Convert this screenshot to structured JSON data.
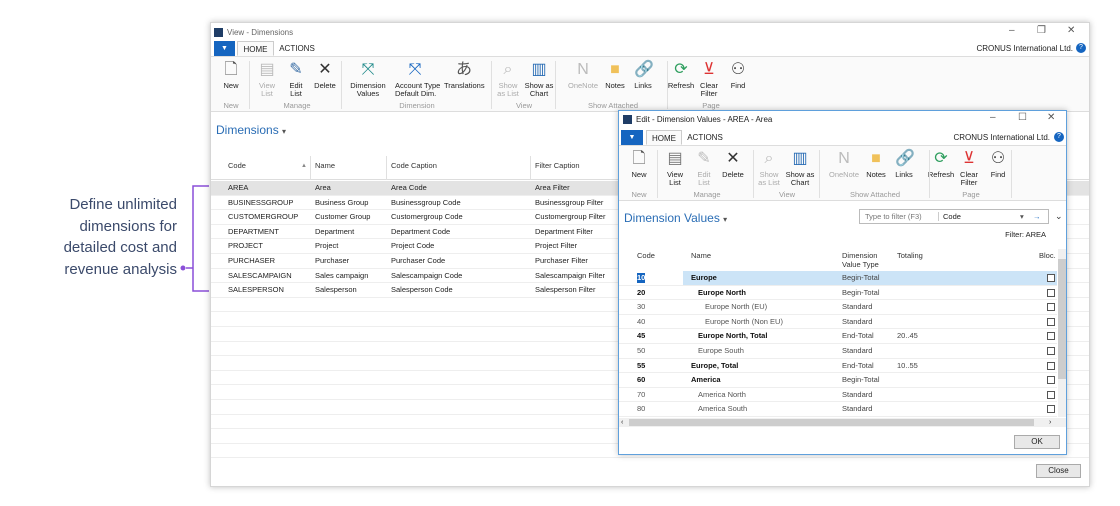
{
  "annotation": {
    "lines": [
      "Define unlimited",
      "dimensions for",
      "detailed cost and",
      "revenue analysis"
    ]
  },
  "colors": {
    "accent": "#1565c0",
    "callout": "#8a4fd8",
    "selected_row": "#cce4f7",
    "title_blue": "#2a6db5"
  },
  "main": {
    "window_title": "View - Dimensions",
    "tabs": [
      "HOME",
      "ACTIONS"
    ],
    "company": "CRONUS International Ltd.",
    "ribbon": {
      "buttons": [
        {
          "label": "New",
          "icon": "new-document-icon"
        },
        {
          "label": "View\nList",
          "icon": "view-list-icon",
          "disabled": true
        },
        {
          "label": "Edit\nList",
          "icon": "edit-list-icon"
        },
        {
          "label": "Delete",
          "icon": "delete-x-icon"
        },
        {
          "label": "Dimension\nValues",
          "icon": "dimension-icon"
        },
        {
          "label": "Account Type\nDefault Dim.",
          "icon": "account-type-icon"
        },
        {
          "label": "Translations",
          "icon": "translations-icon"
        },
        {
          "label": "Show\nas List",
          "icon": "show-list-icon",
          "disabled": true
        },
        {
          "label": "Show as\nChart",
          "icon": "chart-icon"
        },
        {
          "label": "OneNote",
          "icon": "onenote-icon",
          "disabled": true
        },
        {
          "label": "Notes",
          "icon": "notes-icon"
        },
        {
          "label": "Links",
          "icon": "links-icon"
        },
        {
          "label": "Refresh",
          "icon": "refresh-icon"
        },
        {
          "label": "Clear\nFilter",
          "icon": "clear-filter-icon"
        },
        {
          "label": "Find",
          "icon": "find-binoculars-icon"
        }
      ],
      "groups": [
        "New",
        "Manage",
        "Dimension",
        "View",
        "Show Attached",
        "Page"
      ]
    },
    "page_title": "Dimensions",
    "columns": [
      "Code",
      "Name",
      "Code Caption",
      "Filter Caption"
    ],
    "rows": [
      [
        "AREA",
        "Area",
        "Area Code",
        "Area Filter"
      ],
      [
        "BUSINESSGROUP",
        "Business Group",
        "Businessgroup Code",
        "Businessgroup Filter"
      ],
      [
        "CUSTOMERGROUP",
        "Customer Group",
        "Customergroup Code",
        "Customergroup Filter"
      ],
      [
        "DEPARTMENT",
        "Department",
        "Department Code",
        "Department Filter"
      ],
      [
        "PROJECT",
        "Project",
        "Project Code",
        "Project Filter"
      ],
      [
        "PURCHASER",
        "Purchaser",
        "Purchaser Code",
        "Purchaser Filter"
      ],
      [
        "SALESCAMPAIGN",
        "Sales campaign",
        "Salescampaign Code",
        "Salescampaign Filter"
      ],
      [
        "SALESPERSON",
        "Salesperson",
        "Salesperson Code",
        "Salesperson Filter"
      ]
    ],
    "close_label": "Close"
  },
  "dialog": {
    "window_title": "Edit - Dimension Values - AREA - Area",
    "tabs": [
      "HOME",
      "ACTIONS"
    ],
    "company": "CRONUS International Ltd.",
    "ribbon": {
      "buttons": [
        {
          "label": "New",
          "icon": "new-document-icon"
        },
        {
          "label": "View\nList",
          "icon": "view-list-icon"
        },
        {
          "label": "Edit\nList",
          "icon": "edit-list-icon",
          "disabled": true
        },
        {
          "label": "Delete",
          "icon": "delete-x-icon"
        },
        {
          "label": "Show\nas List",
          "icon": "show-list-icon",
          "disabled": true
        },
        {
          "label": "Show as\nChart",
          "icon": "chart-icon"
        },
        {
          "label": "OneNote",
          "icon": "onenote-icon",
          "disabled": true
        },
        {
          "label": "Notes",
          "icon": "notes-icon"
        },
        {
          "label": "Links",
          "icon": "links-icon"
        },
        {
          "label": "Refresh",
          "icon": "refresh-icon"
        },
        {
          "label": "Clear\nFilter",
          "icon": "clear-filter-icon"
        },
        {
          "label": "Find",
          "icon": "find-binoculars-icon"
        }
      ],
      "groups": [
        "New",
        "Manage",
        "View",
        "Show Attached",
        "Page"
      ]
    },
    "page_title": "Dimension Values",
    "filter_placeholder": "Type to filter (F3)",
    "filter_field": "Code",
    "filter_status": "Filter: AREA",
    "columns": [
      "Code",
      "Name",
      "Dimension\nValue Type",
      "Totaling",
      "Bloc."
    ],
    "rows": [
      {
        "code": "10",
        "name": "Europe",
        "type": "Begin-Total",
        "totaling": "",
        "bold": true,
        "indent": 0,
        "blocked": false
      },
      {
        "code": "20",
        "name": "Europe North",
        "type": "Begin-Total",
        "totaling": "",
        "bold": true,
        "indent": 1,
        "blocked": false
      },
      {
        "code": "30",
        "name": "Europe North (EU)",
        "type": "Standard",
        "totaling": "",
        "bold": false,
        "indent": 2,
        "blocked": false
      },
      {
        "code": "40",
        "name": "Europe North (Non EU)",
        "type": "Standard",
        "totaling": "",
        "bold": false,
        "indent": 2,
        "blocked": false
      },
      {
        "code": "45",
        "name": "Europe North, Total",
        "type": "End-Total",
        "totaling": "20..45",
        "bold": true,
        "indent": 1,
        "blocked": false
      },
      {
        "code": "50",
        "name": "Europe South",
        "type": "Standard",
        "totaling": "",
        "bold": false,
        "indent": 1,
        "blocked": false
      },
      {
        "code": "55",
        "name": "Europe, Total",
        "type": "End-Total",
        "totaling": "10..55",
        "bold": true,
        "indent": 0,
        "blocked": false
      },
      {
        "code": "60",
        "name": "America",
        "type": "Begin-Total",
        "totaling": "",
        "bold": true,
        "indent": 0,
        "blocked": false
      },
      {
        "code": "70",
        "name": "America North",
        "type": "Standard",
        "totaling": "",
        "bold": false,
        "indent": 1,
        "blocked": false
      },
      {
        "code": "80",
        "name": "America South",
        "type": "Standard",
        "totaling": "",
        "bold": false,
        "indent": 1,
        "blocked": false
      }
    ],
    "ok_label": "OK"
  }
}
